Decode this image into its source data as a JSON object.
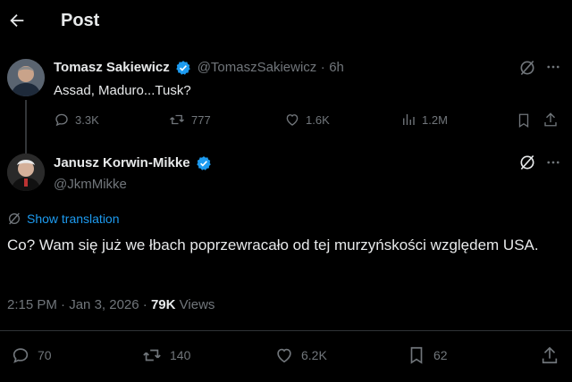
{
  "header": {
    "title": "Post"
  },
  "parent_post": {
    "author_name": "Tomasz Sakiewicz",
    "handle": "@TomaszSakiewicz",
    "separator": "·",
    "time_ago": "6h",
    "text": "Assad, Maduro...Tusk?",
    "replies": "3.3K",
    "reposts": "777",
    "likes": "1.6K",
    "views": "1.2M"
  },
  "main_post": {
    "author_name": "Janusz Korwin-Mikke",
    "handle": "@JkmMikke",
    "show_translation": "Show translation",
    "text": "Co? Wam się już we łbach poprzewracało od tej murzyńskości względem USA.",
    "time": "2:15 PM",
    "date_sep": "·",
    "date": "Jan 3, 2026",
    "views_sep": "·",
    "views_count": "79K",
    "views_label": "Views",
    "replies": "70",
    "reposts": "140",
    "likes": "6.2K",
    "bookmarks": "62"
  },
  "colors": {
    "verified": "#1d9bf0",
    "link": "#1d9bf0",
    "muted": "#71767b",
    "text": "#e7e9ea"
  }
}
